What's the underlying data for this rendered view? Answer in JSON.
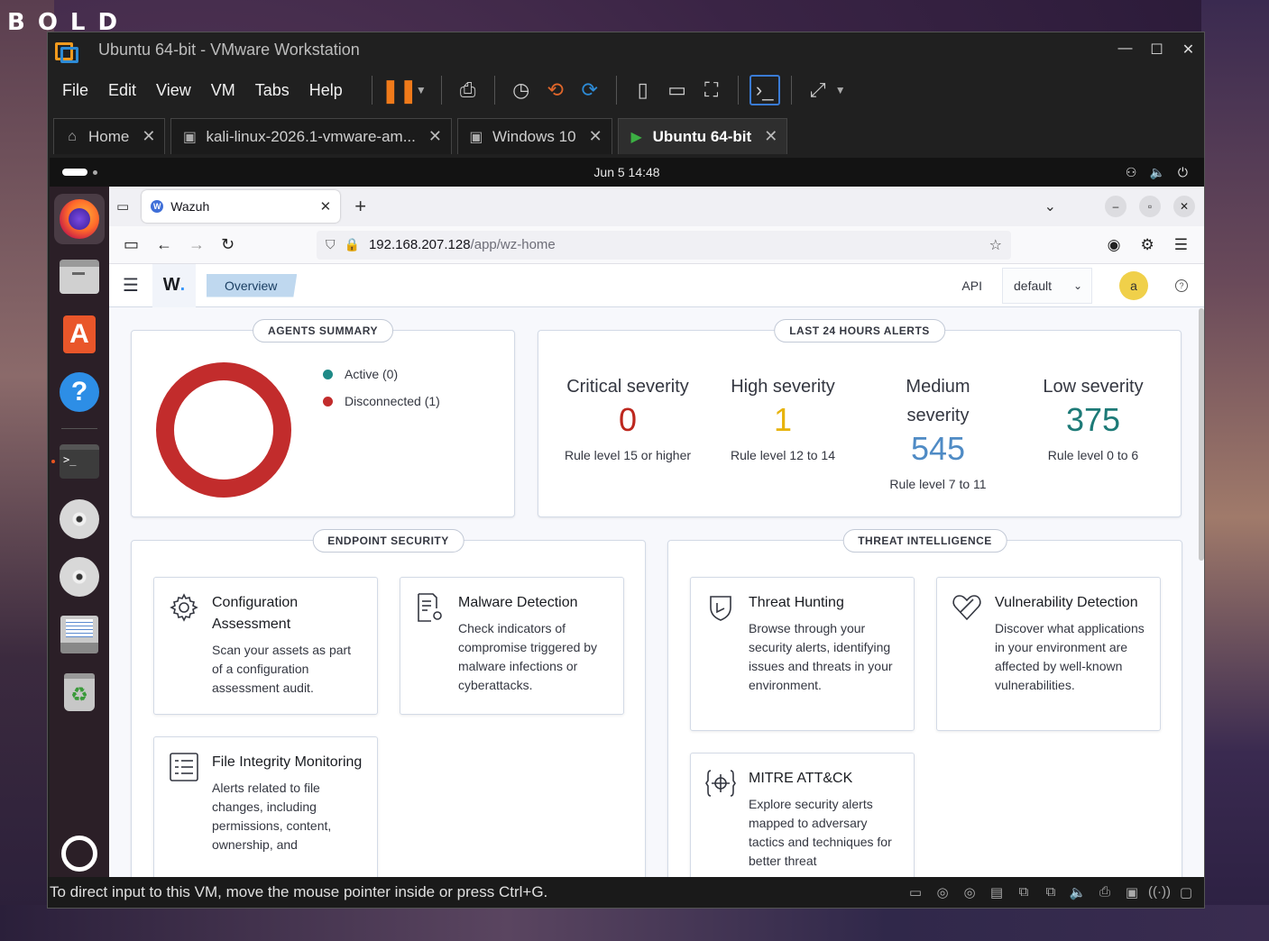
{
  "desktop": {
    "corner_text": "BOLD"
  },
  "vmware": {
    "title": "Ubuntu 64-bit - VMware Workstation",
    "menu": [
      "File",
      "Edit",
      "View",
      "VM",
      "Tabs",
      "Help"
    ],
    "tabs": [
      {
        "label": "Home"
      },
      {
        "label": "kali-linux-2026.1-vmware-am..."
      },
      {
        "label": "Windows 10"
      },
      {
        "label": "Ubuntu 64-bit"
      }
    ],
    "status_text": "To direct input to this VM, move the mouse pointer inside or press Ctrl+G."
  },
  "ubuntu": {
    "clock": "Jun 5  14:48"
  },
  "firefox": {
    "tab_title": "Wazuh",
    "url_host": "192.168.207.128",
    "url_path": "/app/wz-home"
  },
  "wazuh": {
    "logo": "W",
    "breadcrumb": "Overview",
    "api_label": "API",
    "api_select": "default",
    "avatar": "a",
    "agents_summary": {
      "title": "AGENTS SUMMARY",
      "legend": [
        {
          "label": "Active (0)",
          "color": "#1f8a87"
        },
        {
          "label": "Disconnected (1)",
          "color": "#c22c2c"
        }
      ],
      "ring_color": "#c22c2c"
    },
    "alerts": {
      "title": "LAST 24 HOURS ALERTS",
      "items": [
        {
          "title": "Critical severity",
          "value": "0",
          "sub": "Rule level 15 or higher",
          "color": "#bd271e"
        },
        {
          "title": "High severity",
          "value": "1",
          "sub": "Rule level 12 to 14",
          "color": "#e7b30b"
        },
        {
          "title": "Medium severity",
          "value": "545",
          "sub": "Rule level 7 to 11",
          "color": "#4f8bc5"
        },
        {
          "title": "Low severity",
          "value": "375",
          "sub": "Rule level 0 to 6",
          "color": "#1d7a77"
        }
      ]
    },
    "endpoint_security": {
      "title": "ENDPOINT SECURITY",
      "cards": [
        {
          "title": "Configuration Assessment",
          "desc": "Scan your assets as part of a configuration assessment audit.",
          "icon": "gear-icon"
        },
        {
          "title": "Malware Detection",
          "desc": "Check indicators of compromise triggered by malware infections or cyberattacks.",
          "icon": "document-gear-icon"
        },
        {
          "title": "File Integrity Monitoring",
          "desc": "Alerts related to file changes, including permissions, content, ownership, and",
          "icon": "list-icon"
        }
      ]
    },
    "threat_intelligence": {
      "title": "THREAT INTELLIGENCE",
      "cards": [
        {
          "title": "Threat Hunting",
          "desc": "Browse through your security alerts, identifying issues and threats in your environment.",
          "icon": "shield-icon"
        },
        {
          "title": "Vulnerability Detection",
          "desc": "Discover what applications in your environment are affected by well-known vulnerabilities.",
          "icon": "heart-icon"
        },
        {
          "title": "MITRE ATT&CK",
          "desc": "Explore security alerts mapped to adversary tactics and techniques for better threat",
          "icon": "crosshair-icon"
        }
      ]
    }
  }
}
